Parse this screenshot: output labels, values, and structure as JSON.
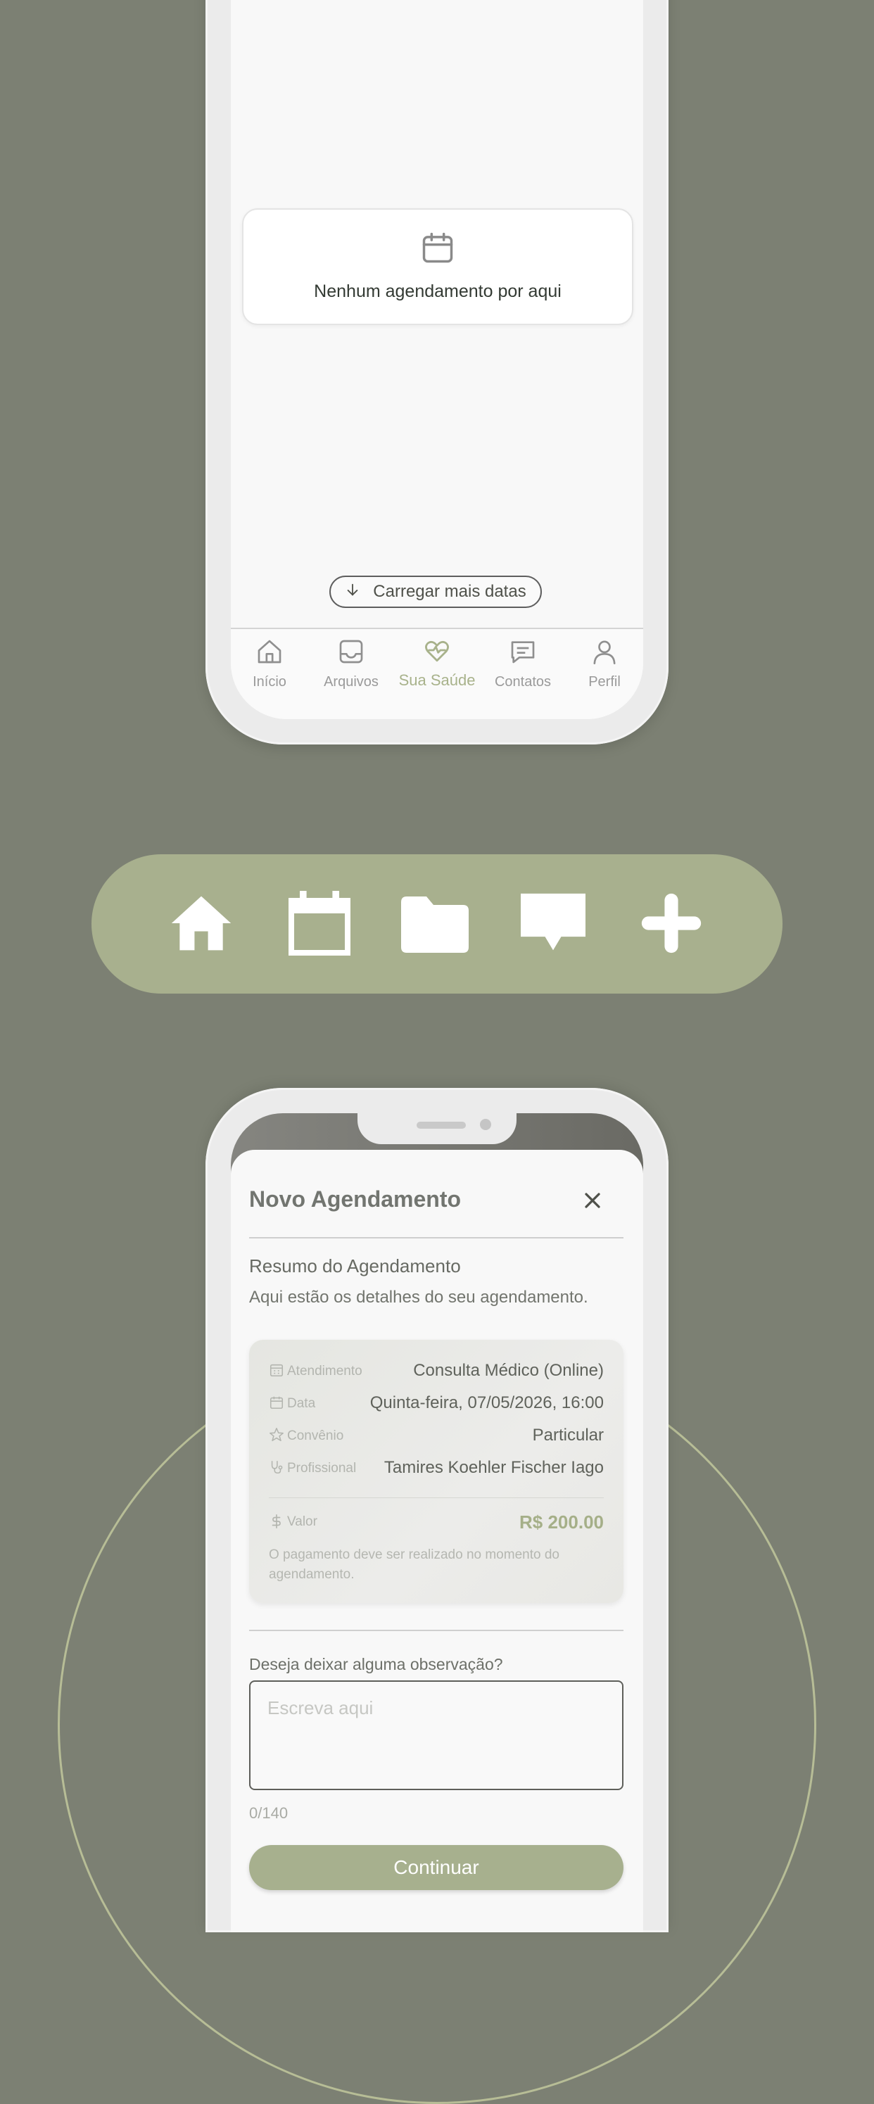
{
  "top_screen": {
    "empty_state": {
      "icon": "calendar-icon",
      "text": "Nenhum agendamento por aqui"
    },
    "load_more": {
      "icon": "arrow-down-icon",
      "label": "Carregar mais datas"
    },
    "bottom_nav": {
      "items": [
        {
          "icon": "home-icon",
          "label": "Início",
          "active": false
        },
        {
          "icon": "inbox-icon",
          "label": "Arquivos",
          "active": false
        },
        {
          "icon": "heart-pulse-icon",
          "label": "Sua Saúde",
          "active": true
        },
        {
          "icon": "message-icon",
          "label": "Contatos",
          "active": false
        },
        {
          "icon": "user-icon",
          "label": "Perfil",
          "active": false
        }
      ]
    }
  },
  "icon_bar": {
    "icons": [
      "home-icon",
      "calendar-icon",
      "folder-icon",
      "chat-bubble-icon",
      "plus-icon"
    ]
  },
  "modal": {
    "title": "Novo Agendamento",
    "close_icon": "close-icon",
    "summary_title": "Resumo do Agendamento",
    "summary_subtitle": "Aqui estão os detalhes do seu agendamento.",
    "details": [
      {
        "icon": "building-icon",
        "label": "Atendimento",
        "value": "Consulta Médico (Online)"
      },
      {
        "icon": "calendar-icon",
        "label": "Data",
        "value": "Quinta-feira, 07/05/2026, 16:00"
      },
      {
        "icon": "star-icon",
        "label": "Convênio",
        "value": "Particular"
      },
      {
        "icon": "stethoscope-icon",
        "label": "Profissional",
        "value": "Tamires Koehler Fischer Iago"
      }
    ],
    "price": {
      "icon": "dollar-icon",
      "label": "Valor",
      "value": "R$ 200.00"
    },
    "payment_note": "O pagamento deve ser realizado no momento do agendamento.",
    "observation": {
      "label": "Deseja deixar alguma observação?",
      "placeholder": "Escreva aqui",
      "value": "",
      "char_count": "0/140"
    },
    "continue_label": "Continuar"
  },
  "colors": {
    "background": "#7c8073",
    "accent": "#a8b08e",
    "circle": "#b7bd96"
  }
}
